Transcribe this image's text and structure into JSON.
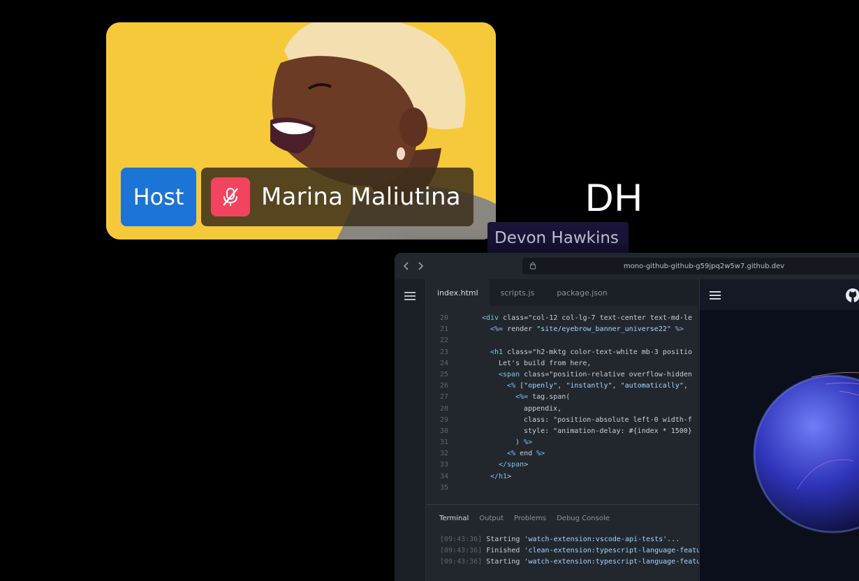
{
  "participants": {
    "host": {
      "badge": "Host",
      "name": "Marina Maliutina",
      "icons": [
        "microphone-muted-icon"
      ]
    },
    "guest": {
      "initials": "DH",
      "name": "Devon Hawkins"
    }
  },
  "browser": {
    "url": "mono-github-github-g59jpq2w5w7.github.dev",
    "icons": [
      "back-arrow-icon",
      "forward-arrow-icon",
      "lock-icon"
    ]
  },
  "editor": {
    "tabs": [
      "index.html",
      "scripts.js",
      "package.json"
    ],
    "active_tab": "index.html",
    "code_lines": [
      {
        "n": "20",
        "indent": 0,
        "text": "<div class=\"col-12 col-lg-7 text-center text-md-le"
      },
      {
        "n": "21",
        "indent": 1,
        "text": "<%= render \"site/eyebrow_banner_universe22\" %>"
      },
      {
        "n": "22",
        "indent": 0,
        "text": ""
      },
      {
        "n": "23",
        "indent": 1,
        "text": "<h1 class=\"h2-mktg color-text-white mb-3 positio"
      },
      {
        "n": "24",
        "indent": 2,
        "text": "Let's build from here,"
      },
      {
        "n": "25",
        "indent": 2,
        "text": "<span class=\"position-relative overflow-hidden"
      },
      {
        "n": "26",
        "indent": 3,
        "text": "<% [\"openly\", \"instantly\", \"automatically\","
      },
      {
        "n": "27",
        "indent": 4,
        "text": "<%= tag.span("
      },
      {
        "n": "28",
        "indent": 5,
        "text": "appendix,"
      },
      {
        "n": "29",
        "indent": 5,
        "text": "class: \"position-absolute left-0 width-f"
      },
      {
        "n": "30",
        "indent": 5,
        "text": "style: \"animation-delay: #{index * 1500}"
      },
      {
        "n": "31",
        "indent": 4,
        "text": ") %>"
      },
      {
        "n": "32",
        "indent": 3,
        "text": "<% end %>"
      },
      {
        "n": "33",
        "indent": 2,
        "text": "</span>"
      },
      {
        "n": "34",
        "indent": 1,
        "text": "</h1>"
      },
      {
        "n": "35",
        "indent": 0,
        "text": ""
      }
    ],
    "panel_tabs": [
      "Terminal",
      "Output",
      "Problems",
      "Debug Console"
    ],
    "active_panel_tab": "Terminal",
    "terminal_lines": [
      {
        "time": "[09:43:36]",
        "verb": "Starting",
        "task": "'watch-extension:vscode-api-tests'",
        "rest": "..."
      },
      {
        "time": "[09:43:36]",
        "verb": "Finished",
        "task": "'clean-extension:typescript-language-featu",
        "rest": ""
      },
      {
        "time": "[09:43:36]",
        "verb": "Starting",
        "task": "'watch-extension:typescript-language-featu",
        "rest": ""
      }
    ],
    "icons": [
      "menu-icon",
      "github-icon",
      "globe-image"
    ]
  },
  "colors": {
    "host_badge": "#1b74d6",
    "mute_button": "#f2445f",
    "tile_background": "#f6c93a",
    "guest_label_bg": "#1a1438"
  }
}
